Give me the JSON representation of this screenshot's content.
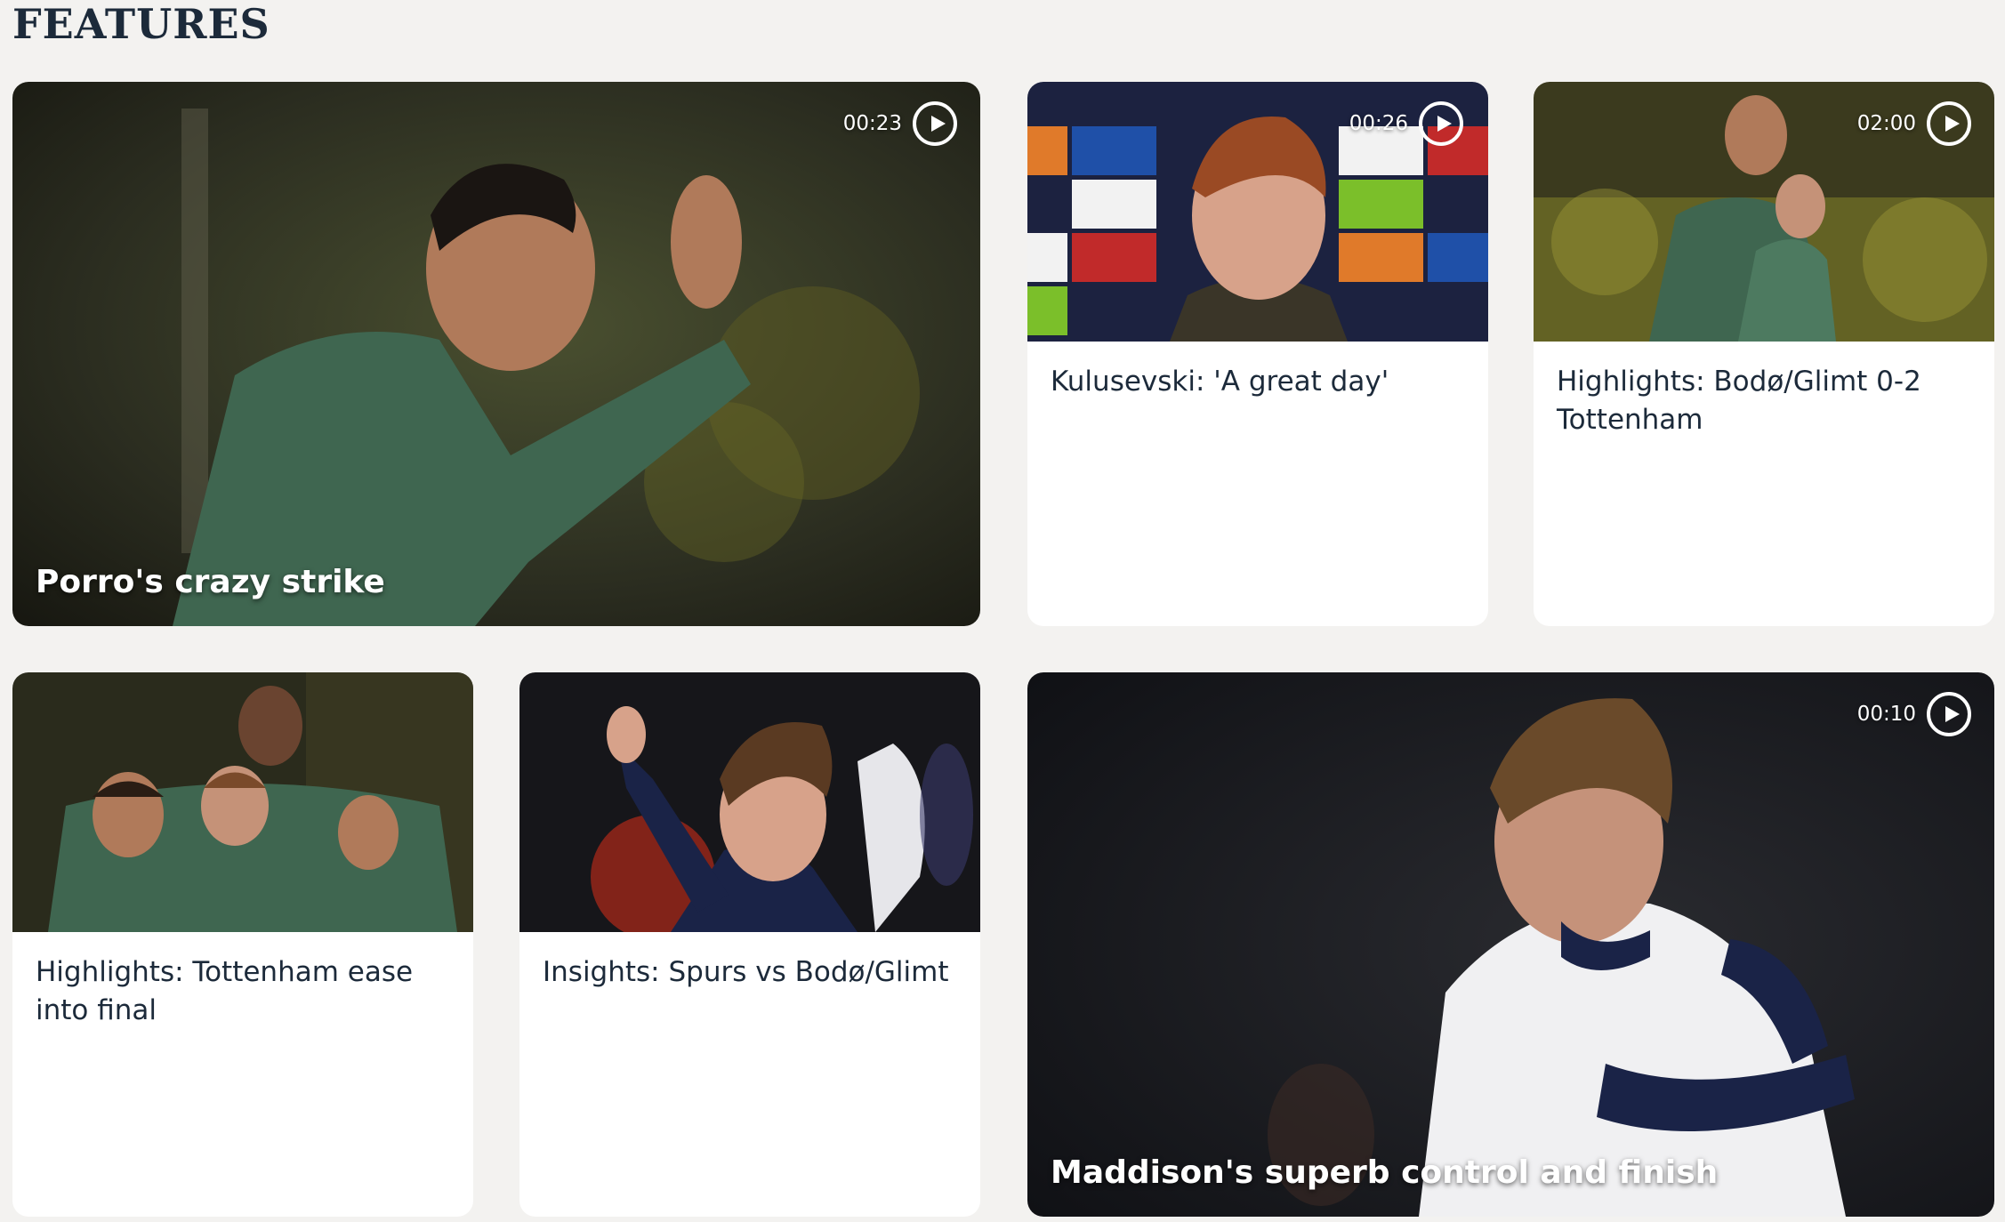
{
  "section": {
    "title": "FEATURES"
  },
  "cards": [
    {
      "title": "Porro's crazy strike",
      "duration": "00:23",
      "type": "video"
    },
    {
      "title": "Kulusevski: 'A great day'",
      "duration": "00:26",
      "type": "video"
    },
    {
      "title": "Highlights: Bodø/Glimt 0-2 Tottenham",
      "duration": "02:00",
      "type": "video"
    },
    {
      "title": "Highlights: Tottenham ease into final",
      "type": "article"
    },
    {
      "title": "Insights: Spurs vs Bodø/Glimt",
      "type": "article"
    },
    {
      "title": "Maddison's superb control and finish",
      "duration": "00:10",
      "type": "video"
    }
  ],
  "colors": {
    "background": "#f3f2f0",
    "title": "#1c2a3a",
    "card": "#ffffff",
    "kit_green": "#3f6650",
    "spurs_navy": "#1a2347"
  },
  "icons": [
    "play-icon"
  ]
}
